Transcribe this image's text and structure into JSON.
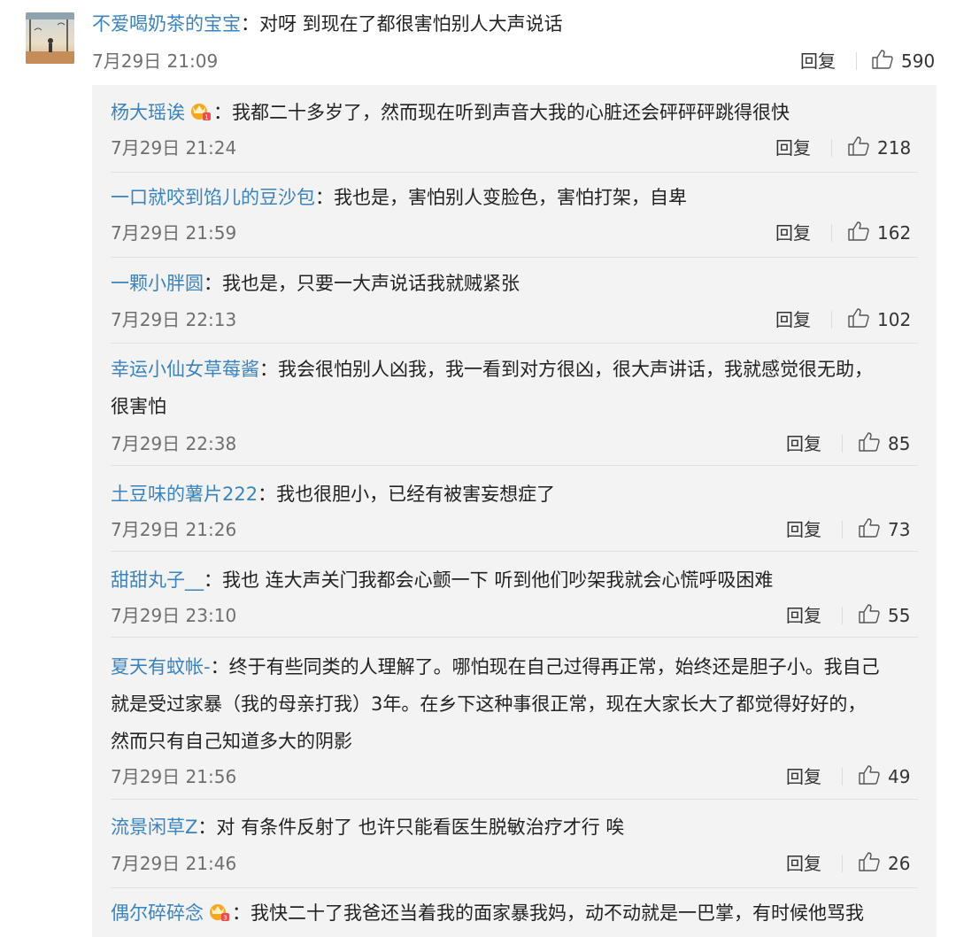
{
  "top_comment": {
    "username": "不爱喝奶茶的宝宝",
    "text": "对呀 到现在了都很害怕别人大声说话",
    "time": "7月29日 21:09",
    "reply_label": "回复",
    "likes": "590"
  },
  "replies": [
    {
      "username": "杨大瑶诶",
      "vip": true,
      "text": "我都二十多岁了，然而现在听到声音大我的心脏还会砰砰砰跳得很快",
      "time": "7月29日 21:24",
      "reply_label": "回复",
      "likes": "218"
    },
    {
      "username": "一口就咬到馅儿的豆沙包",
      "vip": false,
      "text": "我也是，害怕别人变脸色，害怕打架，自卑",
      "time": "7月29日 21:59",
      "reply_label": "回复",
      "likes": "162"
    },
    {
      "username": "一颗小胖圆",
      "vip": false,
      "text": "我也是，只要一大声说话我就贼紧张",
      "time": "7月29日 22:13",
      "reply_label": "回复",
      "likes": "102"
    },
    {
      "username": "幸运小仙女草莓酱",
      "vip": false,
      "text": "我会很怕别人凶我，我一看到对方很凶，很大声讲话，我就感觉很无助，",
      "text2": "很害怕",
      "time": "7月29日 22:38",
      "reply_label": "回复",
      "likes": "85"
    },
    {
      "username": "土豆味的薯片222",
      "vip": false,
      "text": "我也很胆小，已经有被害妄想症了",
      "time": "7月29日 21:26",
      "reply_label": "回复",
      "likes": "73"
    },
    {
      "username": "甜甜丸子__",
      "vip": false,
      "text": "我也 连大声关门我都会心颤一下 听到他们吵架我就会心慌呼吸困难",
      "time": "7月29日 23:10",
      "reply_label": "回复",
      "likes": "55"
    },
    {
      "username": "夏天有蚊帐-",
      "vip": false,
      "text": "终于有些同类的人理解了。哪怕现在自己过得再正常，始终还是胆子小。我自己",
      "text2": "就是受过家暴（我的母亲打我）3年。在乡下这种事很正常，现在大家长大了都觉得好好的，",
      "text3": "然而只有自己知道多大的阴影",
      "time": "7月29日 21:56",
      "reply_label": "回复",
      "likes": "49"
    },
    {
      "username": "流景闲草Z",
      "vip": false,
      "text": "对 有条件反射了 也许只能看医生脱敏治疗才行 唉",
      "time": "7月29日 21:46",
      "reply_label": "回复",
      "likes": "26"
    },
    {
      "username": "偶尔碎碎念",
      "vip": true,
      "text": "我快二十了我爸还当着我的面家暴我妈，动不动就是一巴掌，有时候他骂我",
      "time": "",
      "reply_label": "",
      "likes": ""
    }
  ],
  "colors": {
    "username": "#3b83bd",
    "reply_bg": "#f3f3f3",
    "time": "#6f6f6f"
  }
}
